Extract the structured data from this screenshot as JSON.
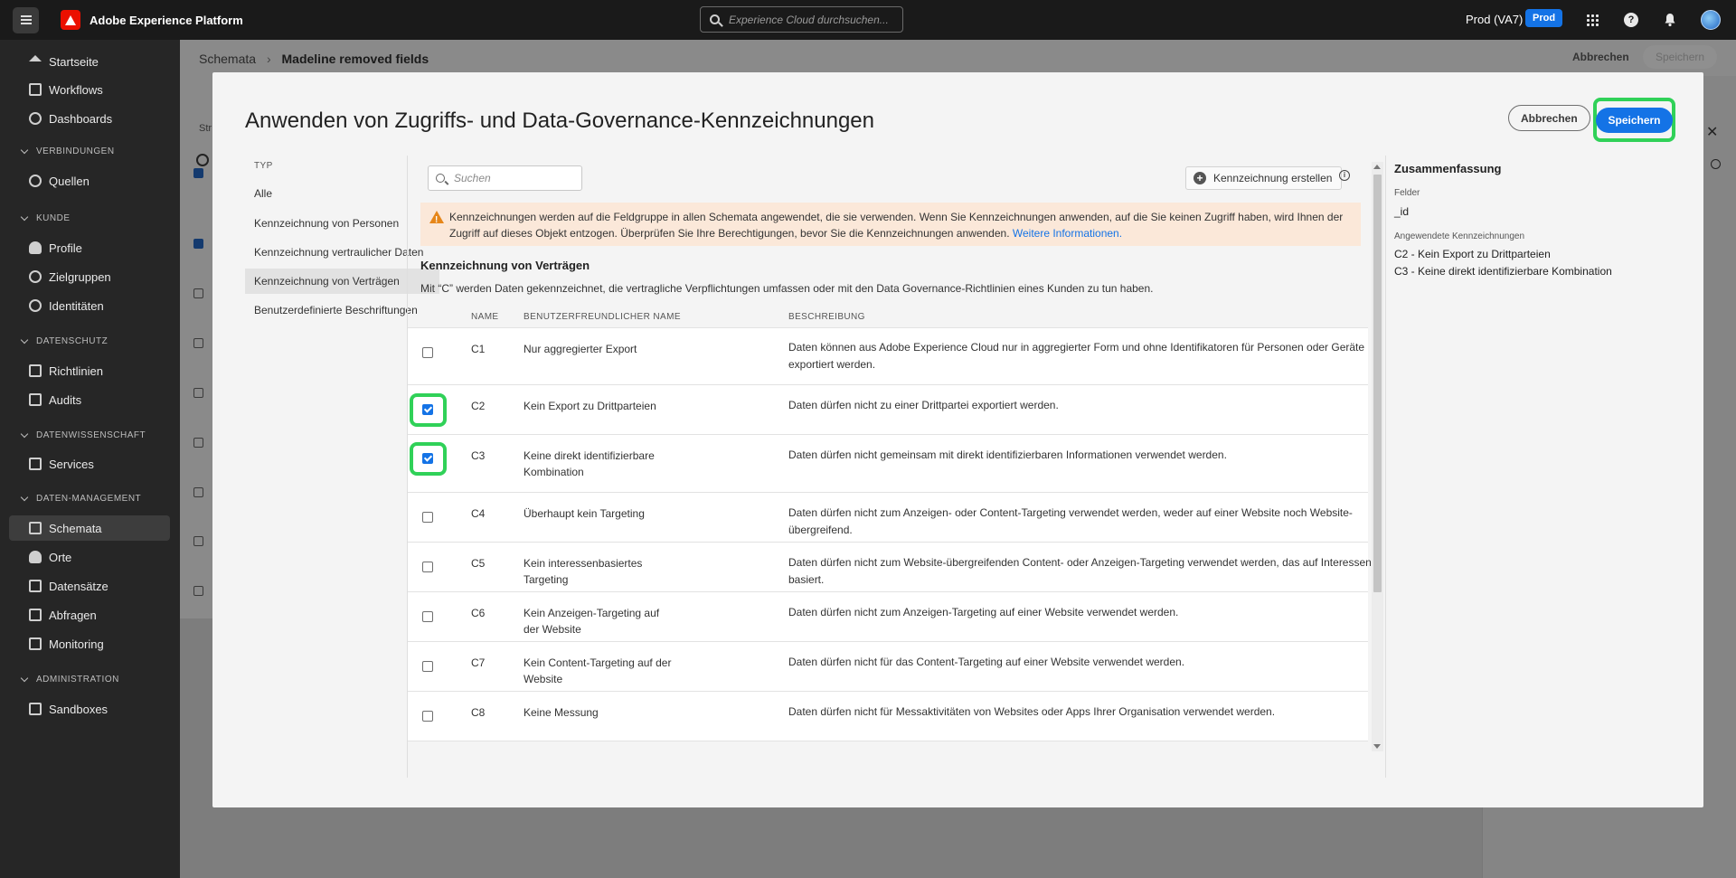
{
  "topbar": {
    "app_title": "Adobe Experience Platform",
    "search_placeholder": "Experience Cloud durchsuchen...",
    "org": "Prod (VA7)",
    "env_badge": "Prod"
  },
  "sidebar": {
    "items": [
      {
        "label": "Startseite"
      },
      {
        "label": "Workflows"
      },
      {
        "label": "Dashboards"
      },
      {
        "label": "Quellen"
      },
      {
        "label": "Profile"
      },
      {
        "label": "Zielgruppen"
      },
      {
        "label": "Identitäten"
      },
      {
        "label": "Richtlinien"
      },
      {
        "label": "Audits"
      },
      {
        "label": "Services"
      },
      {
        "label": "Schemata"
      },
      {
        "label": "Orte"
      },
      {
        "label": "Datensätze"
      },
      {
        "label": "Abfragen"
      },
      {
        "label": "Monitoring"
      },
      {
        "label": "Sandboxes"
      }
    ],
    "sections": [
      "VERBINDUNGEN",
      "KUNDE",
      "DATENSCHUTZ",
      "DATENWISSENSCHAFT",
      "DATEN-MANAGEMENT",
      "ADMINISTRATION"
    ],
    "active": "Schemata"
  },
  "page": {
    "breadcrumb_root": "Schemata",
    "breadcrumb_current": "Madeline removed fields",
    "cancel": "Abbrechen",
    "save": "Speichern",
    "tab_fragment": "Str"
  },
  "modal": {
    "title": "Anwenden von Zugriffs- und Data-Governance-Kennzeichnungen",
    "cancel": "Abbrechen",
    "save": "Speichern",
    "type_label": "TYP",
    "types": [
      {
        "label": "Alle"
      },
      {
        "label": "Kennzeichnung von Personen"
      },
      {
        "label": "Kennzeichnung vertraulicher Daten"
      },
      {
        "label": "Kennzeichnung von Verträgen"
      },
      {
        "label": "Benutzerdefinierte Beschriftungen"
      }
    ],
    "active_type": "Kennzeichnung von Verträgen",
    "search_placeholder": "Suchen",
    "create_label": "Kennzeichnung erstellen",
    "warning_text": "Kennzeichnungen werden auf die Feldgruppe in allen Schemata angewendet, die sie verwenden. Wenn Sie Kennzeichnungen anwenden, auf die Sie keinen Zugriff haben, wird Ihnen der Zugriff auf dieses Objekt entzogen. Überprüfen Sie Ihre Berechtigungen, bevor Sie die Kennzeichnungen anwenden.",
    "warning_link": "Weitere Informationen.",
    "section_title": "Kennzeichnung von Verträgen",
    "section_desc": "Mit “C” werden Daten gekennzeichnet, die vertragliche Verpflichtungen umfassen oder mit den Data Governance-Richtlinien eines Kunden zu tun haben.",
    "columns": {
      "name": "NAME",
      "friendly": "BENUTZERFREUNDLICHER NAME",
      "desc": "BESCHREIBUNG"
    },
    "rows": [
      {
        "name": "C1",
        "friendly": "Nur aggregierter Export",
        "desc": "Daten können aus Adobe Experience Cloud nur in aggregierter Form und ohne Identifikatoren für Personen oder Geräte exportiert werden.",
        "checked": false
      },
      {
        "name": "C2",
        "friendly": "Kein Export zu Drittparteien",
        "desc": "Daten dürfen nicht zu einer Drittpartei exportiert werden.",
        "checked": true
      },
      {
        "name": "C3",
        "friendly": "Keine direkt identifizierbare Kombination",
        "desc": "Daten dürfen nicht gemeinsam mit direkt identifizierbaren Informationen verwendet werden.",
        "checked": true
      },
      {
        "name": "C4",
        "friendly": "Überhaupt kein Targeting",
        "desc": "Daten dürfen nicht zum Anzeigen- oder Content-Targeting verwendet werden, weder auf einer Website noch Website-übergreifend.",
        "checked": false
      },
      {
        "name": "C5",
        "friendly": "Kein interessenbasiertes Targeting",
        "desc": "Daten dürfen nicht zum Website-übergreifenden Content- oder Anzeigen-Targeting verwendet werden, das auf Interessen basiert.",
        "checked": false
      },
      {
        "name": "C6",
        "friendly": "Kein Anzeigen-Targeting auf der Website",
        "desc": "Daten dürfen nicht zum Anzeigen-Targeting auf einer Website verwendet werden.",
        "checked": false
      },
      {
        "name": "C7",
        "friendly": "Kein Content-Targeting auf der Website",
        "desc": "Daten dürfen nicht für das Content-Targeting auf einer Website verwendet werden.",
        "checked": false
      },
      {
        "name": "C8",
        "friendly": "Keine Messung",
        "desc": "Daten dürfen nicht für Messaktivitäten von Websites oder Apps Ihrer Organisation verwendet werden.",
        "checked": false
      }
    ]
  },
  "summary": {
    "title": "Zusammenfassung",
    "fields_label": "Felder",
    "field_value": "_id",
    "applied_label": "Angewendete Kennzeichnungen",
    "applied": [
      "C2 - Kein Export zu Drittparteien",
      "C3 - Keine direkt identifizierbare Kombination"
    ]
  },
  "colors": {
    "accent": "#1473e6",
    "highlight": "#30d158",
    "warning_bg": "#fbe8d9",
    "warning_icon": "#e68619"
  }
}
